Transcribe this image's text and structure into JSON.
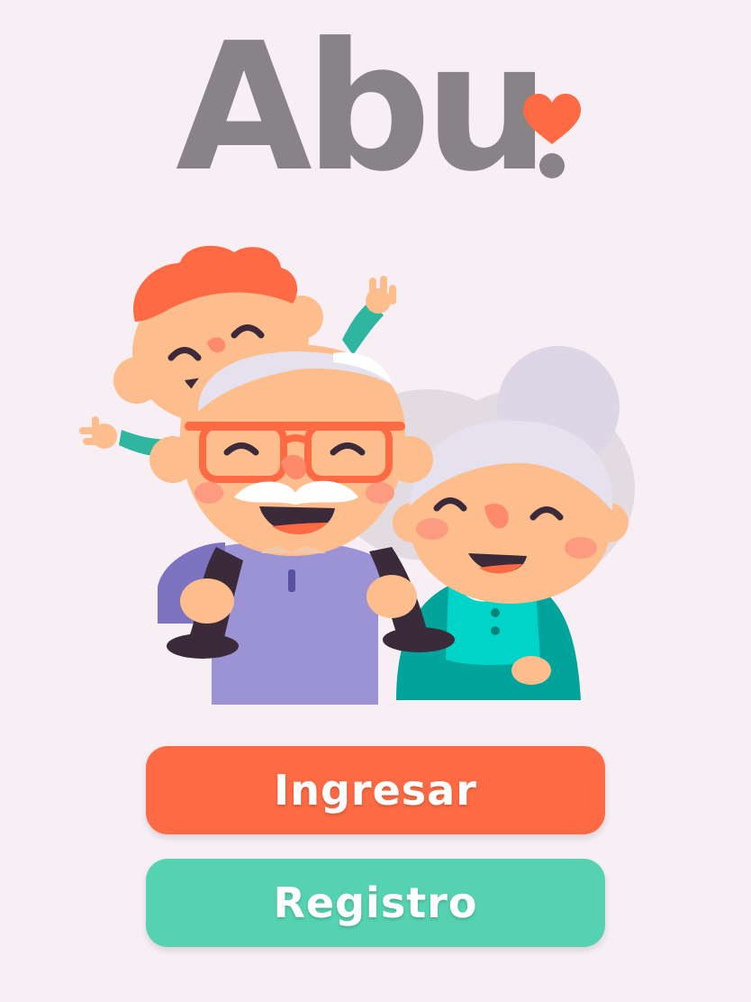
{
  "logo": {
    "text": "Abu",
    "text_color": "#888386",
    "heart_color": "#fd6a43"
  },
  "actions": {
    "login_label": "Ingresar",
    "register_label": "Registro"
  },
  "colors": {
    "background": "#f8eff4",
    "primary": "#fd6a43",
    "secondary": "#55d2b1"
  }
}
